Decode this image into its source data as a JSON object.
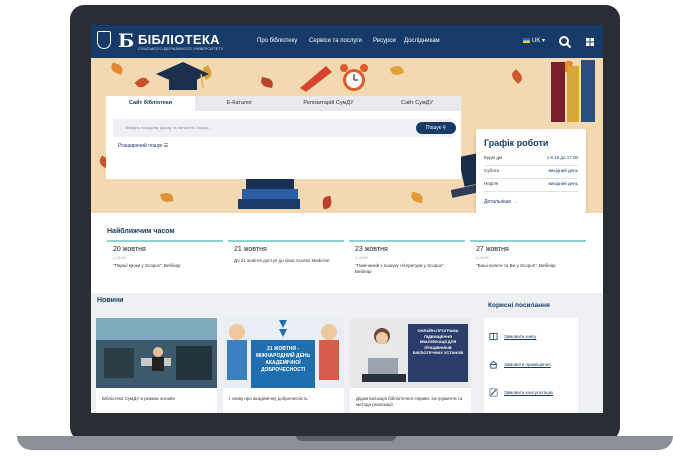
{
  "header": {
    "logo_letter": "Б",
    "logo_title": "БІБЛІОТЕКА",
    "logo_subtitle": "СУМСЬКОГО ДЕРЖАВНОГО УНІВЕРСИТЕТУ",
    "nav": [
      "Про бібліотеку",
      "Сервіси та послуги",
      "Ресурси",
      "Дослідникам"
    ],
    "lang": "UK",
    "brand_color": "#173b68"
  },
  "search": {
    "tabs": [
      "Сайт бібліотеки",
      "Е-Каталог",
      "Репозитарій СумДУ",
      "Сайт СумДУ"
    ],
    "active_tab": 0,
    "placeholder": "Введіть пошукову фразу та натисніть Пошук...",
    "button": "Пошук",
    "advanced": "Розширений пошук"
  },
  "schedule": {
    "title": "Графік роботи",
    "rows": [
      {
        "label": "Будні дні",
        "value": "з 8.15 до 17.00"
      },
      {
        "label": "Субота",
        "value": "вихідний день"
      },
      {
        "label": "Неділя",
        "value": "вихідний день"
      }
    ],
    "more": "Детальніше →"
  },
  "events": {
    "title": "Найближчим часом",
    "items": [
      {
        "date": "20 жовтня",
        "time": "11:00",
        "text": "\"Перші кроки у Scopus\". Вебінар"
      },
      {
        "date": "21 жовтня",
        "time": "",
        "text": "До 21 жовтня доступ до бази Access Medicine"
      },
      {
        "date": "23 жовтня",
        "time": "11:00",
        "text": "\"Помічників з пошуку літератури у Scopus\". Вебінар"
      },
      {
        "date": "27 жовтня",
        "time": "11:00",
        "text": "\"Ваші колеги та Ви у Scopus\". Вебінар"
      }
    ]
  },
  "news": {
    "title": "Новини",
    "items": [
      {
        "caption": "Бібліотека СумДУ в режимі онлайн"
      },
      {
        "caption": "І знову про академічну доброчесність",
        "banner": "21 ЖОВТНЯ - МІЖНАРОДНИЙ ДЕНЬ АКАДЕМІЧНОЇ ДОБРОЧЕСНОСТІ"
      },
      {
        "caption": "Діджиталізація бібліотечної справи: інструменти та методи реалізації",
        "banner": "ОНЛАЙН-ПРОГРАМА ПІДВИЩЕННЯ КВАЛІФІКАЦІЇ ДЛЯ ПРАЦІВНИКІВ БІБЛІОТЕЧНИХ УСТАНОВ"
      }
    ]
  },
  "links": {
    "title": "Корисні посилання",
    "items": [
      "Замовити книгу",
      "Замовити приміщення",
      "Замовити консультацію"
    ]
  }
}
